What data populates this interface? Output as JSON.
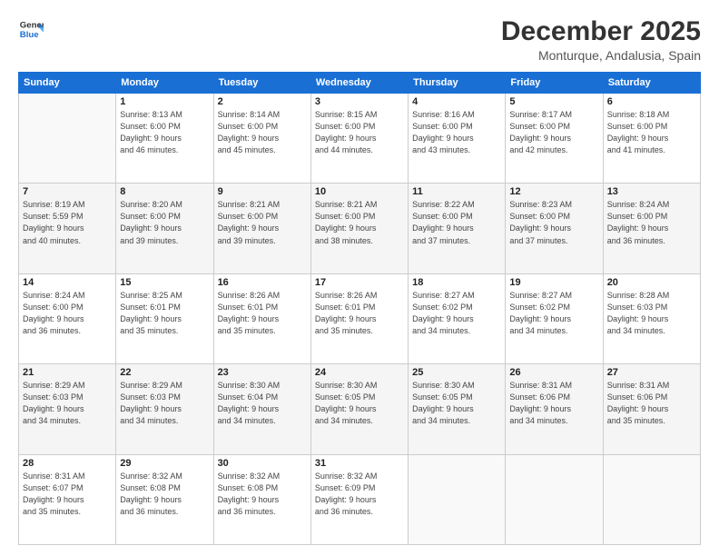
{
  "logo": {
    "line1": "General",
    "line2": "Blue"
  },
  "header": {
    "title": "December 2025",
    "subtitle": "Monturque, Andalusia, Spain"
  },
  "weekdays": [
    "Sunday",
    "Monday",
    "Tuesday",
    "Wednesday",
    "Thursday",
    "Friday",
    "Saturday"
  ],
  "weeks": [
    [
      {
        "day": "",
        "info": ""
      },
      {
        "day": "1",
        "info": "Sunrise: 8:13 AM\nSunset: 6:00 PM\nDaylight: 9 hours\nand 46 minutes."
      },
      {
        "day": "2",
        "info": "Sunrise: 8:14 AM\nSunset: 6:00 PM\nDaylight: 9 hours\nand 45 minutes."
      },
      {
        "day": "3",
        "info": "Sunrise: 8:15 AM\nSunset: 6:00 PM\nDaylight: 9 hours\nand 44 minutes."
      },
      {
        "day": "4",
        "info": "Sunrise: 8:16 AM\nSunset: 6:00 PM\nDaylight: 9 hours\nand 43 minutes."
      },
      {
        "day": "5",
        "info": "Sunrise: 8:17 AM\nSunset: 6:00 PM\nDaylight: 9 hours\nand 42 minutes."
      },
      {
        "day": "6",
        "info": "Sunrise: 8:18 AM\nSunset: 6:00 PM\nDaylight: 9 hours\nand 41 minutes."
      }
    ],
    [
      {
        "day": "7",
        "info": "Sunrise: 8:19 AM\nSunset: 5:59 PM\nDaylight: 9 hours\nand 40 minutes."
      },
      {
        "day": "8",
        "info": "Sunrise: 8:20 AM\nSunset: 6:00 PM\nDaylight: 9 hours\nand 39 minutes."
      },
      {
        "day": "9",
        "info": "Sunrise: 8:21 AM\nSunset: 6:00 PM\nDaylight: 9 hours\nand 39 minutes."
      },
      {
        "day": "10",
        "info": "Sunrise: 8:21 AM\nSunset: 6:00 PM\nDaylight: 9 hours\nand 38 minutes."
      },
      {
        "day": "11",
        "info": "Sunrise: 8:22 AM\nSunset: 6:00 PM\nDaylight: 9 hours\nand 37 minutes."
      },
      {
        "day": "12",
        "info": "Sunrise: 8:23 AM\nSunset: 6:00 PM\nDaylight: 9 hours\nand 37 minutes."
      },
      {
        "day": "13",
        "info": "Sunrise: 8:24 AM\nSunset: 6:00 PM\nDaylight: 9 hours\nand 36 minutes."
      }
    ],
    [
      {
        "day": "14",
        "info": "Sunrise: 8:24 AM\nSunset: 6:00 PM\nDaylight: 9 hours\nand 36 minutes."
      },
      {
        "day": "15",
        "info": "Sunrise: 8:25 AM\nSunset: 6:01 PM\nDaylight: 9 hours\nand 35 minutes."
      },
      {
        "day": "16",
        "info": "Sunrise: 8:26 AM\nSunset: 6:01 PM\nDaylight: 9 hours\nand 35 minutes."
      },
      {
        "day": "17",
        "info": "Sunrise: 8:26 AM\nSunset: 6:01 PM\nDaylight: 9 hours\nand 35 minutes."
      },
      {
        "day": "18",
        "info": "Sunrise: 8:27 AM\nSunset: 6:02 PM\nDaylight: 9 hours\nand 34 minutes."
      },
      {
        "day": "19",
        "info": "Sunrise: 8:27 AM\nSunset: 6:02 PM\nDaylight: 9 hours\nand 34 minutes."
      },
      {
        "day": "20",
        "info": "Sunrise: 8:28 AM\nSunset: 6:03 PM\nDaylight: 9 hours\nand 34 minutes."
      }
    ],
    [
      {
        "day": "21",
        "info": "Sunrise: 8:29 AM\nSunset: 6:03 PM\nDaylight: 9 hours\nand 34 minutes."
      },
      {
        "day": "22",
        "info": "Sunrise: 8:29 AM\nSunset: 6:03 PM\nDaylight: 9 hours\nand 34 minutes."
      },
      {
        "day": "23",
        "info": "Sunrise: 8:30 AM\nSunset: 6:04 PM\nDaylight: 9 hours\nand 34 minutes."
      },
      {
        "day": "24",
        "info": "Sunrise: 8:30 AM\nSunset: 6:05 PM\nDaylight: 9 hours\nand 34 minutes."
      },
      {
        "day": "25",
        "info": "Sunrise: 8:30 AM\nSunset: 6:05 PM\nDaylight: 9 hours\nand 34 minutes."
      },
      {
        "day": "26",
        "info": "Sunrise: 8:31 AM\nSunset: 6:06 PM\nDaylight: 9 hours\nand 34 minutes."
      },
      {
        "day": "27",
        "info": "Sunrise: 8:31 AM\nSunset: 6:06 PM\nDaylight: 9 hours\nand 35 minutes."
      }
    ],
    [
      {
        "day": "28",
        "info": "Sunrise: 8:31 AM\nSunset: 6:07 PM\nDaylight: 9 hours\nand 35 minutes."
      },
      {
        "day": "29",
        "info": "Sunrise: 8:32 AM\nSunset: 6:08 PM\nDaylight: 9 hours\nand 36 minutes."
      },
      {
        "day": "30",
        "info": "Sunrise: 8:32 AM\nSunset: 6:08 PM\nDaylight: 9 hours\nand 36 minutes."
      },
      {
        "day": "31",
        "info": "Sunrise: 8:32 AM\nSunset: 6:09 PM\nDaylight: 9 hours\nand 36 minutes."
      },
      {
        "day": "",
        "info": ""
      },
      {
        "day": "",
        "info": ""
      },
      {
        "day": "",
        "info": ""
      }
    ]
  ]
}
